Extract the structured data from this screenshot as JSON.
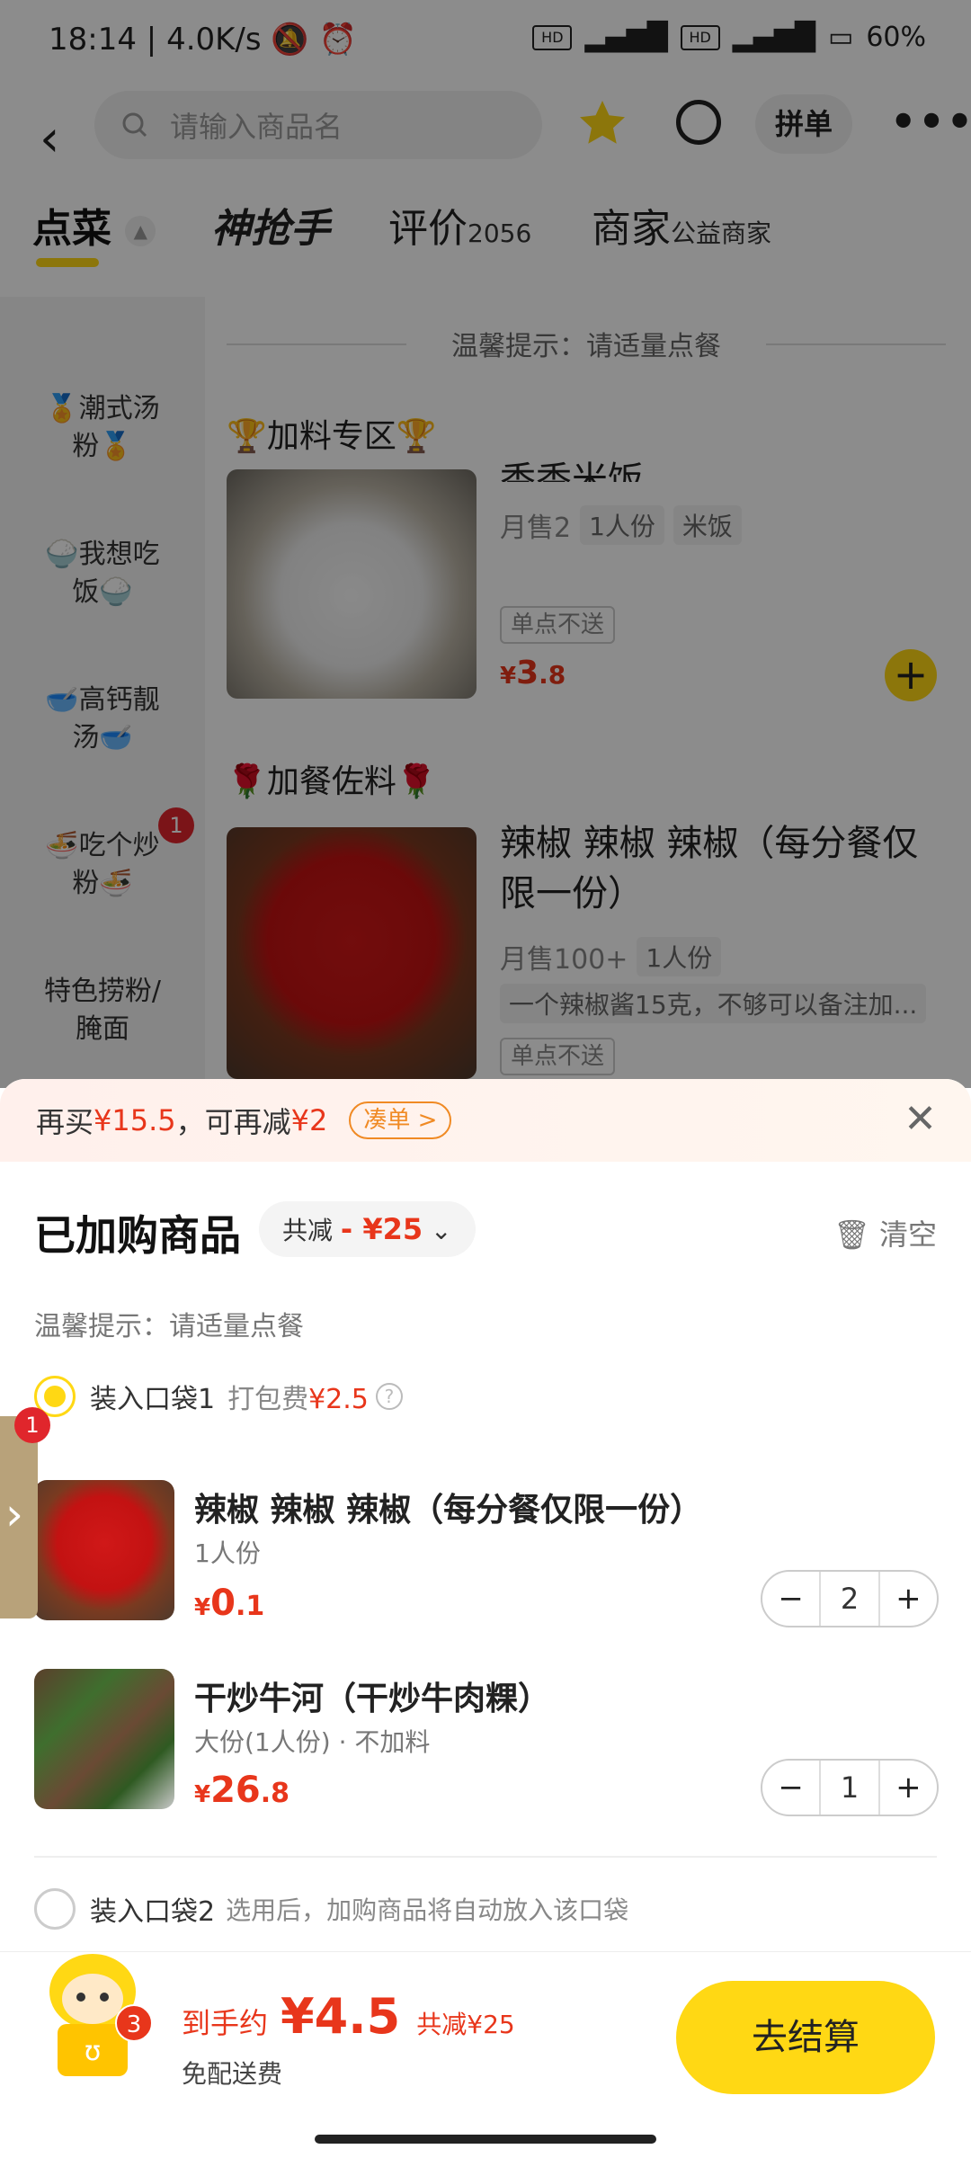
{
  "status_bar": {
    "time": "18:14",
    "speed": "4.0K/s",
    "battery": "60%",
    "hd1": "HD",
    "hd2": "HD",
    "net": "5G"
  },
  "search": {
    "placeholder": "请输入商品名"
  },
  "top_actions": {
    "group_order": "拼单"
  },
  "tabs": {
    "order": "点菜",
    "shenqiangshou": "神抢手",
    "review": "评价",
    "review_count": "2056",
    "merchant": "商家",
    "merchant_tag": "公益商家"
  },
  "sidebar": {
    "items": [
      {
        "label": "🏅潮式汤粉🏅"
      },
      {
        "label": "🍚我想吃饭🍚"
      },
      {
        "label": "🥣高钙靓汤🥣"
      },
      {
        "label": "🍜吃个炒粉🍜",
        "badge": "1"
      },
      {
        "label": "特色捞粉/腌面"
      }
    ]
  },
  "menu": {
    "tip": "温馨提示：请适量点餐",
    "section1": "🏆加料专区🏆",
    "item1": {
      "name": "香香米饭",
      "sales": "月售2",
      "tags": [
        "1人份",
        "米饭"
      ],
      "no_delivery": "单点不送",
      "currency": "¥",
      "price_int": "3",
      "price_dec": ".8"
    },
    "section2": "🌹加餐佐料🌹",
    "item2": {
      "name": "辣椒 辣椒 辣椒（每分餐仅限一份）",
      "sales": "月售100+",
      "tags": [
        "1人份"
      ],
      "desc": "一个辣椒酱15克，不够可以备注加...",
      "no_delivery": "单点不送"
    }
  },
  "cart_sheet": {
    "promo": {
      "text1": "再买",
      "amount1": "¥15.5",
      "text2": "，可再减",
      "amount2": "¥2",
      "chip": "凑单 >"
    },
    "title": "已加购商品",
    "discount_label": "共减",
    "discount_value": "- ¥25",
    "clear": "清空",
    "tip": "温馨提示：请适量点餐",
    "bag1": {
      "label": "装入口袋1",
      "fee_label": "打包费",
      "fee": "¥2.5"
    },
    "items": [
      {
        "name": "辣椒 辣椒 辣椒（每分餐仅限一份）",
        "spec": "1人份",
        "currency": "¥",
        "price_int": "0",
        "price_dec": ".1",
        "qty": "2"
      },
      {
        "name": "干炒牛河（干炒牛肉粿）",
        "spec": "大份(1人份) · 不加料",
        "currency": "¥",
        "price_int": "26",
        "price_dec": ".8",
        "qty": "1"
      }
    ],
    "bag2": {
      "label": "装入口袋2",
      "note": "选用后，加购商品将自动放入该口袋"
    },
    "side_badge": "1"
  },
  "checkout": {
    "count": "3",
    "label": "到手约",
    "amount": "¥4.5",
    "off": "共减¥25",
    "shipping": "免配送费",
    "button": "去结算"
  },
  "colors": {
    "accent": "#ffd814",
    "price_red": "#e8361b",
    "badge_red": "#e0262c"
  }
}
